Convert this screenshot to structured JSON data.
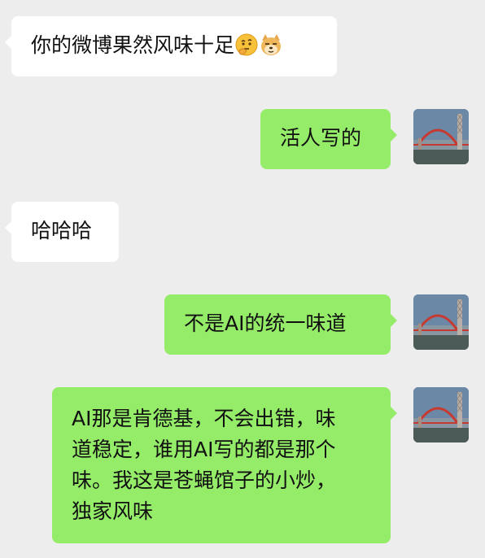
{
  "chat": {
    "messages": [
      {
        "side": "in",
        "text": "你的微博果然风味十足",
        "emojis": [
          "thinking-face-emoji",
          "doge-emoji"
        ]
      },
      {
        "side": "out",
        "text": "活人写的"
      },
      {
        "side": "in",
        "text": "哈哈哈"
      },
      {
        "side": "out",
        "text": "不是AI的统一味道"
      },
      {
        "side": "out",
        "lines": [
          "AI那是肯德基，不会出错，味",
          "道稳定，谁用AI写的都是那个",
          "味。我这是苍蝇馆子的小炒，",
          "独家风味"
        ]
      }
    ]
  },
  "colors": {
    "background": "#ededed",
    "incoming_bubble": "#ffffff",
    "outgoing_bubble": "#95ec69"
  },
  "icons": {
    "avatar": "bridge-photo-avatar"
  }
}
